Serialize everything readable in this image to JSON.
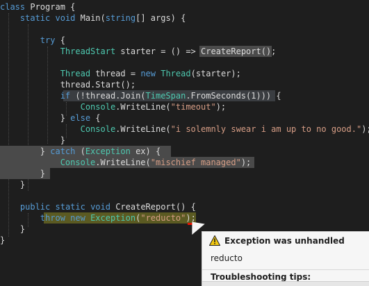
{
  "code": {
    "l1": {
      "class_kw": "class",
      "class_name": " Program {"
    },
    "l2": {
      "indent": "    ",
      "static_kw": "static",
      "void_kw": " void",
      "rest": " Main(",
      "string_kw": "string",
      "rest2": "[] args) {"
    },
    "l4": {
      "indent": "        ",
      "try_kw": "try",
      "rest": " {"
    },
    "l5": {
      "indent": "            ",
      "type": "ThreadStart",
      "mid": " starter = () => ",
      "call": "CreateReport",
      "end": "();"
    },
    "l7": {
      "indent": "            ",
      "type": "Thread",
      "mid": " thread = ",
      "new_kw": "new",
      "sp": " ",
      "type2": "Thread",
      "end": "(starter);"
    },
    "l8": {
      "indent": "            ",
      "text": "thread.Start();"
    },
    "l9": {
      "indent": "            ",
      "if_kw": "if",
      "a": " (!thread.Join(",
      "ts": "TimeSpan",
      "b": ".FromSeconds(1))) {"
    },
    "l10": {
      "indent": "                ",
      "cons": "Console",
      "b": ".WriteLine(",
      "s": "\"timeout\"",
      "e": ");"
    },
    "l11": {
      "indent": "            ",
      "a": "} ",
      "else_kw": "else",
      "b": " {"
    },
    "l12": {
      "indent": "                ",
      "cons": "Console",
      "b": ".WriteLine(",
      "s": "\"i solemnly swear i am up to no good.\"",
      "e": ");"
    },
    "l13": {
      "indent": "            ",
      "text": "}"
    },
    "l14": {
      "indent": "        ",
      "a": "} ",
      "catch_kw": "catch",
      "b": " (",
      "exc": "Exception",
      "c": " ex) {"
    },
    "l15": {
      "indent": "            ",
      "cons": "Console",
      "b": ".WriteLine(",
      "s": "\"mischief managed\"",
      "e": ");"
    },
    "l16": {
      "indent": "        ",
      "text": "}"
    },
    "l17": {
      "indent": "    ",
      "text": "}"
    },
    "l19": {
      "indent": "    ",
      "public_kw": "public",
      "static_kw": " static",
      "void_kw": " void",
      "rest": " CreateReport() {"
    },
    "l20": {
      "indent": "        ",
      "throw_kw": "throw",
      "sp": " ",
      "new_kw": "new",
      "sp2": " ",
      "exc": "Exception",
      "a": "(",
      "s": "\"reducto\"",
      "e": ");"
    },
    "l21": {
      "indent": "    ",
      "text": "}"
    },
    "l22": {
      "text": "}"
    }
  },
  "exception_popup": {
    "title": "Exception was unhandled",
    "message": "reducto",
    "tips_header": "Troubleshooting tips:",
    "icon": "warning-icon"
  },
  "colors": {
    "background": "#1e1e1e",
    "keyword": "#569cd6",
    "type": "#4ec9b0",
    "string": "#d69d85",
    "text": "#dcdcdc"
  }
}
